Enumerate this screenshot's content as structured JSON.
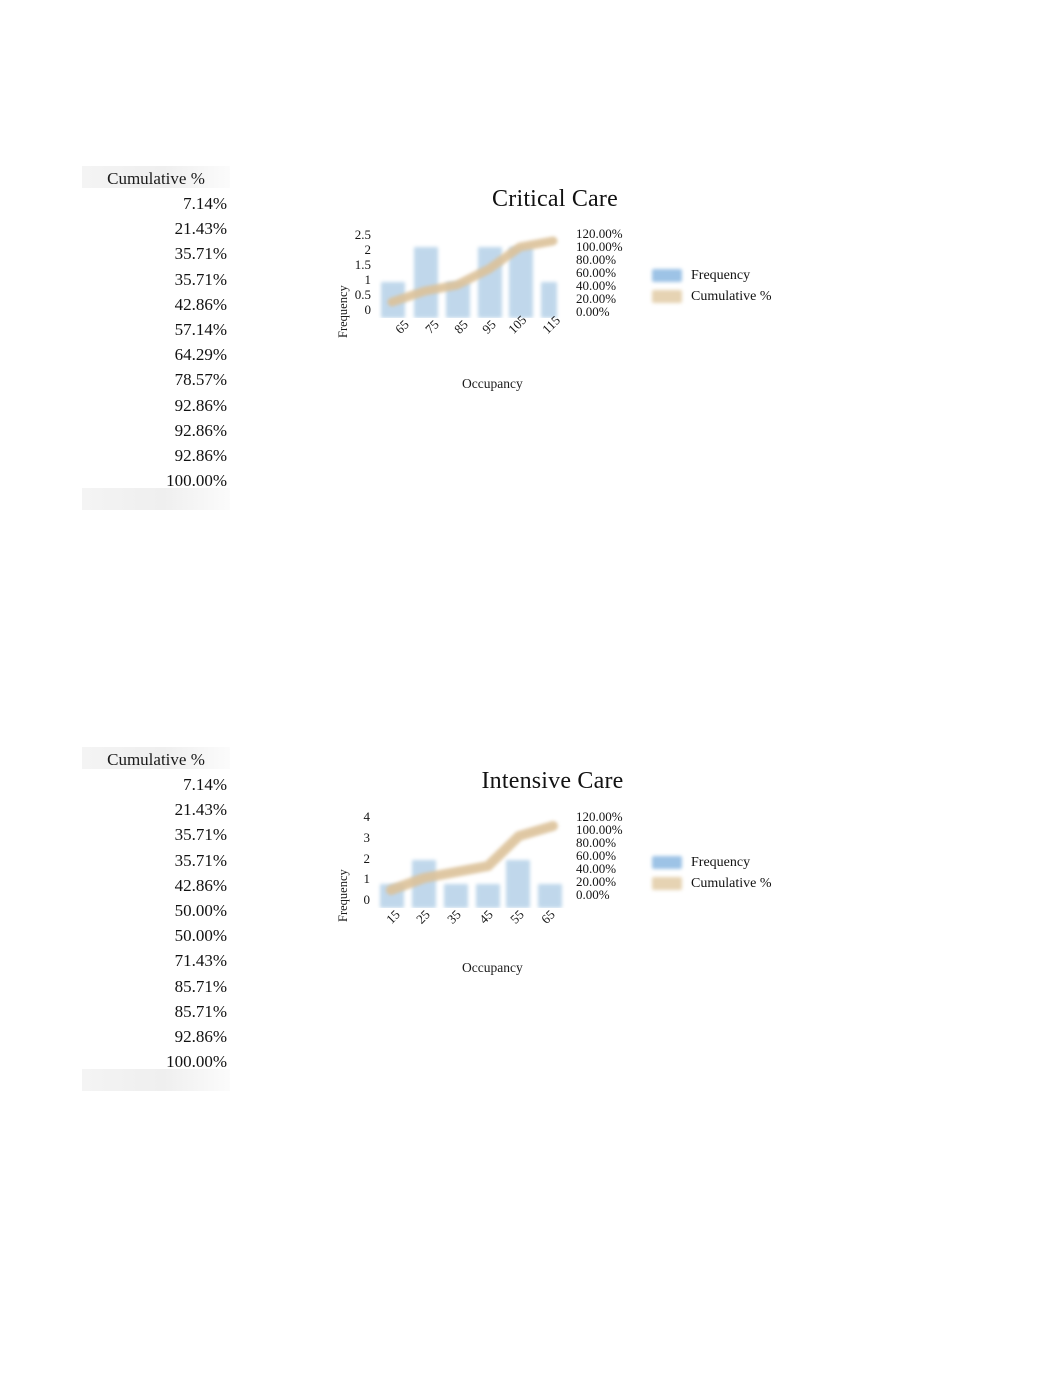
{
  "colors": {
    "frequency_bar": "#9DC3E6",
    "cumulative_line": "#E6D3B3",
    "text": "#111111",
    "band": "#ECECEC"
  },
  "sections": [
    {
      "table": {
        "header": "Cumulative %",
        "values": [
          "7.14%",
          "21.43%",
          "35.71%",
          "35.71%",
          "42.86%",
          "57.14%",
          "64.29%",
          "78.57%",
          "92.86%",
          "92.86%",
          "92.86%",
          "100.00%"
        ]
      },
      "chart": {
        "title": "Critical Care",
        "xlabel": "Occupancy",
        "ylabel": "Frequency",
        "yticks": [
          "2.5",
          "2",
          "1.5",
          "1",
          "0.5",
          "0"
        ],
        "y2ticks": [
          "120.00%",
          "100.00%",
          "80.00%",
          "60.00%",
          "40.00%",
          "20.00%",
          "0.00%"
        ],
        "xticks": [
          "65",
          "75",
          "85",
          "95",
          "105",
          "115"
        ],
        "legend": [
          "Frequency",
          "Cumulative %"
        ]
      }
    },
    {
      "table": {
        "header": "Cumulative %",
        "values": [
          "7.14%",
          "21.43%",
          "35.71%",
          "35.71%",
          "42.86%",
          "50.00%",
          "50.00%",
          "71.43%",
          "85.71%",
          "85.71%",
          "92.86%",
          "100.00%"
        ]
      },
      "chart": {
        "title": "Intensive Care",
        "xlabel": "Occupancy",
        "ylabel": "Frequency",
        "yticks": [
          "4",
          "3",
          "2",
          "1",
          "0"
        ],
        "y2ticks": [
          "120.00%",
          "100.00%",
          "80.00%",
          "60.00%",
          "40.00%",
          "20.00%",
          "0.00%"
        ],
        "xticks": [
          "15",
          "25",
          "35",
          "45",
          "55",
          "65"
        ],
        "legend": [
          "Frequency",
          "Cumulative %"
        ]
      }
    }
  ],
  "chart_data": [
    {
      "type": "bar",
      "title": "Critical Care",
      "xlabel": "Occupancy",
      "ylabel": "Frequency",
      "y2label": "Cumulative %",
      "categories": [
        "65",
        "75",
        "85",
        "95",
        "105",
        "115"
      ],
      "grid": false,
      "legend_position": "right",
      "ylim": [
        0,
        2.5
      ],
      "y2lim": [
        0,
        1.2
      ],
      "series": [
        {
          "name": "Frequency",
          "type": "bar",
          "values": [
            1,
            2,
            1,
            2,
            2,
            1
          ],
          "axis": "left"
        },
        {
          "name": "Cumulative %",
          "type": "line",
          "values": [
            0.2143,
            0.3571,
            0.4286,
            0.6429,
            0.9286,
            1.0
          ],
          "axis": "right"
        }
      ],
      "table_cumulative_percent": [
        "7.14%",
        "21.43%",
        "35.71%",
        "35.71%",
        "42.86%",
        "57.14%",
        "64.29%",
        "78.57%",
        "92.86%",
        "92.86%",
        "92.86%",
        "100.00%"
      ]
    },
    {
      "type": "bar",
      "title": "Intensive Care",
      "xlabel": "Occupancy",
      "ylabel": "Frequency",
      "y2label": "Cumulative %",
      "categories": [
        "15",
        "25",
        "35",
        "45",
        "55",
        "65"
      ],
      "grid": false,
      "legend_position": "right",
      "ylim": [
        0,
        4
      ],
      "y2lim": [
        0,
        1.2
      ],
      "series": [
        {
          "name": "Frequency",
          "type": "bar",
          "values": [
            1,
            2,
            1,
            1,
            2,
            1
          ],
          "axis": "left"
        },
        {
          "name": "Cumulative %",
          "type": "line",
          "values": [
            0.2143,
            0.3571,
            0.4286,
            0.5,
            0.8571,
            1.0
          ],
          "axis": "right"
        }
      ],
      "table_cumulative_percent": [
        "7.14%",
        "21.43%",
        "35.71%",
        "35.71%",
        "42.86%",
        "50.00%",
        "50.00%",
        "71.43%",
        "85.71%",
        "85.71%",
        "92.86%",
        "100.00%"
      ]
    }
  ]
}
